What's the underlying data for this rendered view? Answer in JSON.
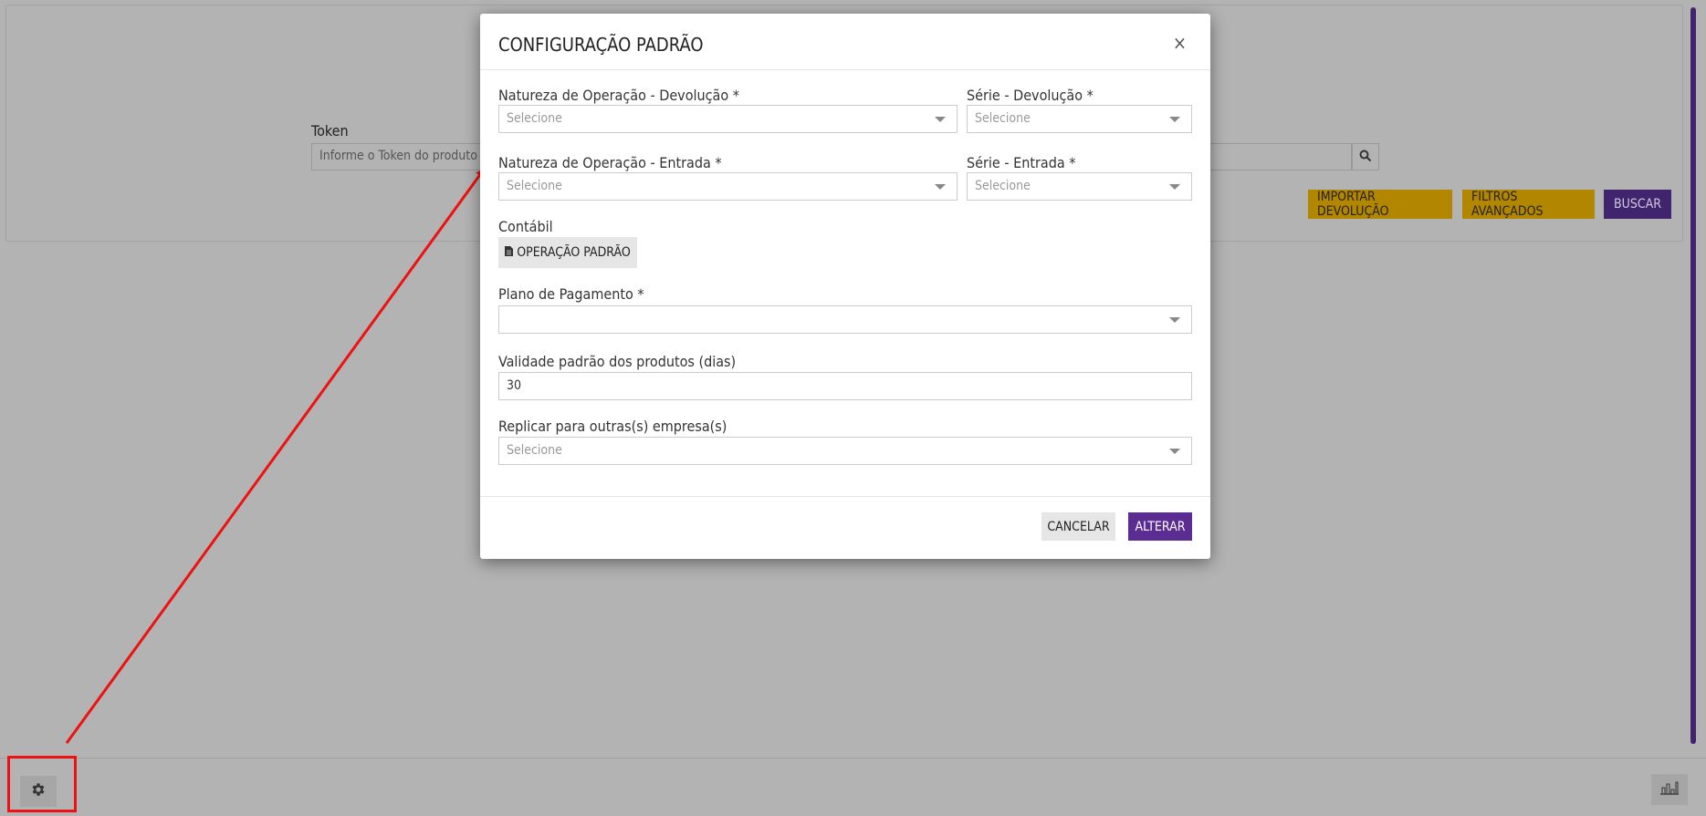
{
  "background": {
    "token_label": "Token",
    "token_placeholder": "Informe o Token do produto",
    "buttons": {
      "import_label": "IMPORTAR DEVOLUÇÃO",
      "filters_label": "FILTROS AVANÇADOS",
      "search_label": "BUSCAR"
    },
    "colors": {
      "accent_yellow": "#b38600",
      "accent_purple": "#40256e"
    }
  },
  "modal": {
    "title": "CONFIGURAÇÃO PADRÃO",
    "close_symbol": "×",
    "fields": {
      "natureza_devolucao": {
        "label": "Natureza de Operação - Devolução *",
        "placeholder": "Selecione"
      },
      "serie_devolucao": {
        "label": "Série - Devolução *",
        "placeholder": "Selecione"
      },
      "natureza_entrada": {
        "label": "Natureza de Operação - Entrada *",
        "placeholder": "Selecione"
      },
      "serie_entrada": {
        "label": "Série - Entrada *",
        "placeholder": "Selecione"
      },
      "contabil": {
        "label": "Contábil",
        "button_label": "OPERAÇÃO PADRÃO"
      },
      "plano_pagamento": {
        "label": "Plano de Pagamento *",
        "value": ""
      },
      "validade": {
        "label": "Validade padrão dos produtos (dias)",
        "value": "30"
      },
      "replicar": {
        "label": "Replicar para outras(s) empresa(s)",
        "placeholder": "Selecione"
      }
    },
    "footer": {
      "cancel_label": "CANCELAR",
      "alter_label": "ALTERAR"
    },
    "colors": {
      "primary": "#5b2c91",
      "secondary": "#e6e6e6"
    }
  },
  "footer_bar": {
    "left_icon": "gear-icon",
    "right_icon": "bar-chart-icon"
  },
  "annotation": {
    "highlight_color": "#ee1111"
  }
}
